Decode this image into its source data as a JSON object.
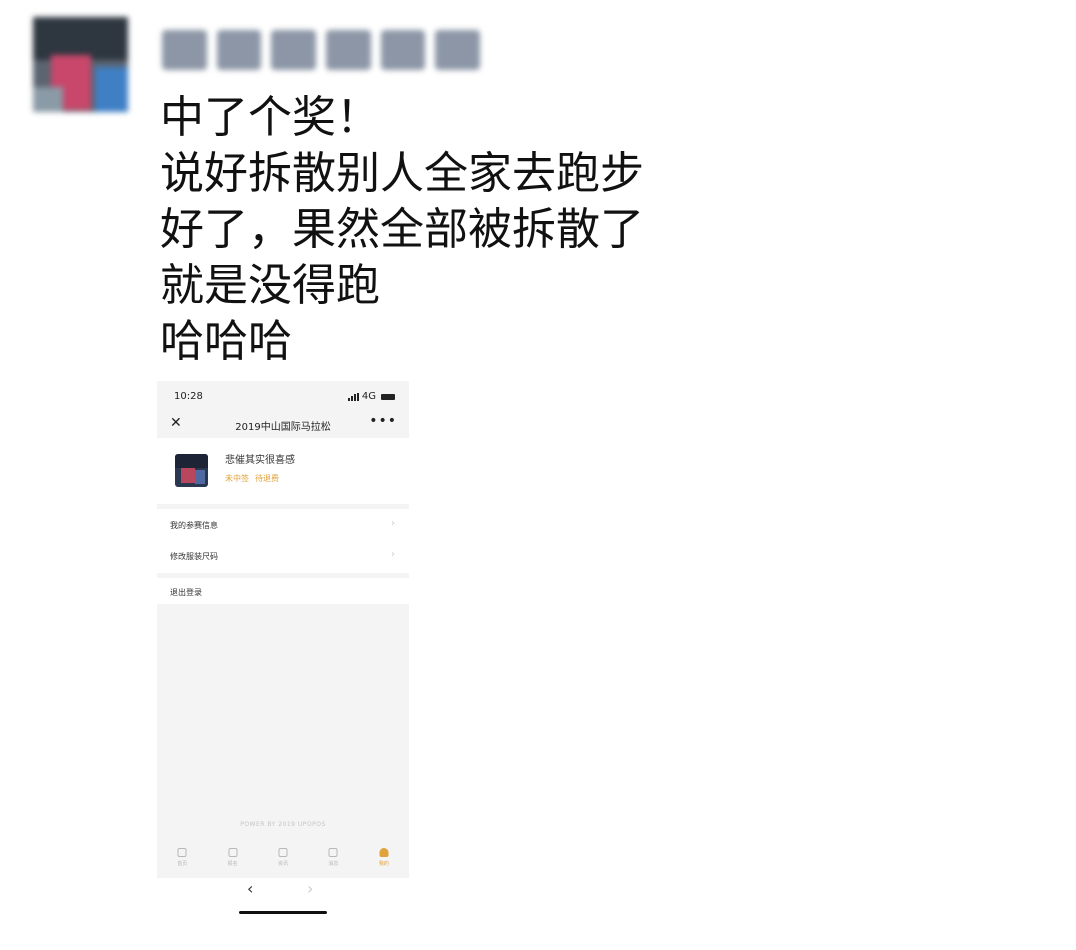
{
  "post": {
    "lines": [
      "中了个奖！",
      "说好拆散别人全家去跑步",
      "好了，果然全部被拆散了",
      "就是没得跑",
      "哈哈哈"
    ]
  },
  "phone": {
    "status": {
      "time": "10:28",
      "network": "4G"
    },
    "header": {
      "close_icon": "close-icon",
      "title": "2019中山国际马拉松",
      "more_icon": "more-dots-icon"
    },
    "profile": {
      "name": "悲催其实很喜感",
      "tags": [
        "未中签",
        "待退费"
      ]
    },
    "menu": [
      {
        "label": "我的参赛信息"
      },
      {
        "label": "修改服装尺码"
      }
    ],
    "logout_label": "退出登录",
    "powered_by": "POWER BY 2019 UPOPOS",
    "tabs": [
      {
        "label": "首页",
        "icon": "home-icon"
      },
      {
        "label": "报名",
        "icon": "register-icon"
      },
      {
        "label": "资讯",
        "icon": "news-icon"
      },
      {
        "label": "消息",
        "icon": "message-icon"
      },
      {
        "label": "我的",
        "icon": "user-icon",
        "active": true
      }
    ],
    "accent_color": "#e0a23a"
  }
}
